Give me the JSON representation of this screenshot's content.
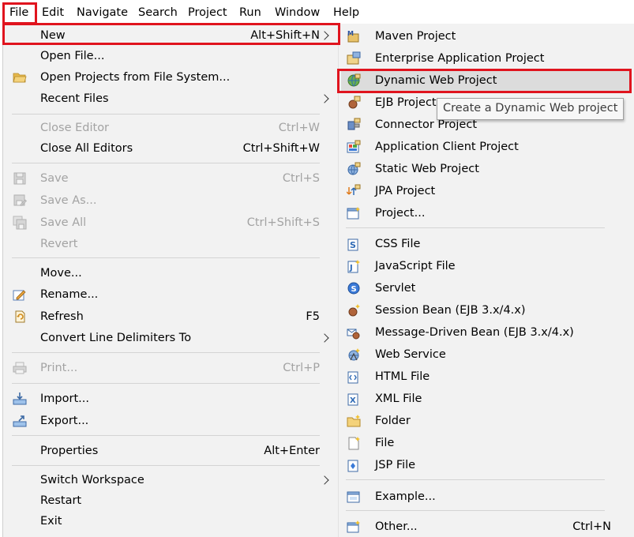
{
  "menubar": {
    "items": [
      "File",
      "Edit",
      "Navigate",
      "Search",
      "Project",
      "Run",
      "Window",
      "Help"
    ]
  },
  "file_menu": {
    "new": {
      "label": "New",
      "shortcut": "Alt+Shift+N"
    },
    "open_file": {
      "label": "Open File..."
    },
    "open_projects": {
      "label": "Open Projects from File System..."
    },
    "recent_files": {
      "label": "Recent Files"
    },
    "close_editor": {
      "label": "Close Editor",
      "shortcut": "Ctrl+W"
    },
    "close_all_editors": {
      "label": "Close All Editors",
      "shortcut": "Ctrl+Shift+W"
    },
    "save": {
      "label": "Save",
      "shortcut": "Ctrl+S"
    },
    "save_as": {
      "label": "Save As..."
    },
    "save_all": {
      "label": "Save All",
      "shortcut": "Ctrl+Shift+S"
    },
    "revert": {
      "label": "Revert"
    },
    "move": {
      "label": "Move..."
    },
    "rename": {
      "label": "Rename..."
    },
    "refresh": {
      "label": "Refresh",
      "shortcut": "F5"
    },
    "convert_line_delimiters": {
      "label": "Convert Line Delimiters To"
    },
    "print": {
      "label": "Print...",
      "shortcut": "Ctrl+P"
    },
    "import": {
      "label": "Import..."
    },
    "export": {
      "label": "Export..."
    },
    "properties": {
      "label": "Properties",
      "shortcut": "Alt+Enter"
    },
    "switch_workspace": {
      "label": "Switch Workspace"
    },
    "restart": {
      "label": "Restart"
    },
    "exit": {
      "label": "Exit"
    }
  },
  "new_menu": {
    "maven_project": {
      "label": "Maven Project"
    },
    "enterprise_app_project": {
      "label": "Enterprise Application Project"
    },
    "dynamic_web_project": {
      "label": "Dynamic Web Project"
    },
    "ejb_project": {
      "label": "EJB Project"
    },
    "connector_project": {
      "label": "Connector Project"
    },
    "app_client_project": {
      "label": "Application Client Project"
    },
    "static_web_project": {
      "label": "Static Web Project"
    },
    "jpa_project": {
      "label": "JPA Project"
    },
    "project": {
      "label": "Project..."
    },
    "css_file": {
      "label": "CSS File"
    },
    "javascript_file": {
      "label": "JavaScript File"
    },
    "servlet": {
      "label": "Servlet"
    },
    "session_bean": {
      "label": "Session Bean (EJB 3.x/4.x)"
    },
    "message_driven_bean": {
      "label": "Message-Driven Bean (EJB 3.x/4.x)"
    },
    "web_service": {
      "label": "Web Service"
    },
    "html_file": {
      "label": "HTML File"
    },
    "xml_file": {
      "label": "XML File"
    },
    "folder": {
      "label": "Folder"
    },
    "file": {
      "label": "File"
    },
    "jsp_file": {
      "label": "JSP File"
    },
    "example": {
      "label": "Example..."
    },
    "other": {
      "label": "Other...",
      "shortcut": "Ctrl+N"
    }
  },
  "tooltip": {
    "text": "Create a Dynamic Web project"
  },
  "colors": {
    "highlight_border": "#e0141e",
    "menu_bg": "#f2f2f2",
    "disabled_text": "#a3a3a3",
    "hover_bg": "#dcdcdc"
  }
}
